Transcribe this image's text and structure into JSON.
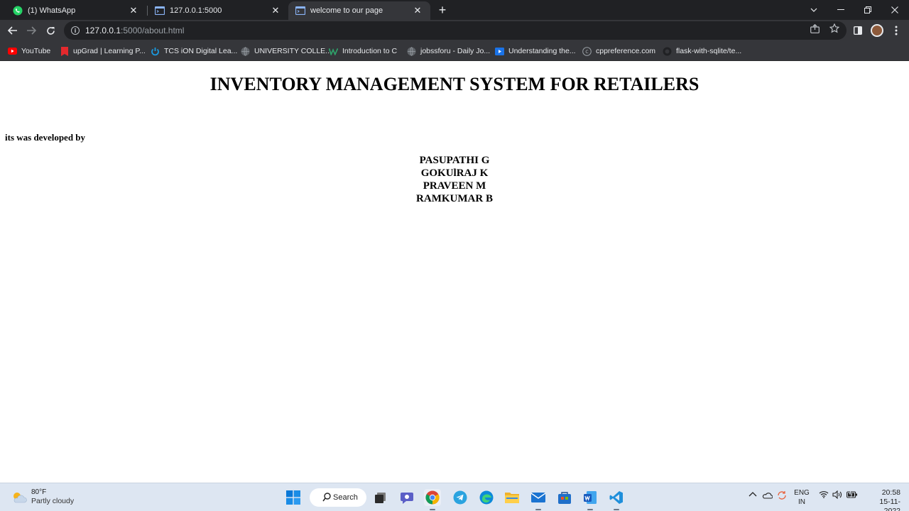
{
  "browser": {
    "tabs": [
      {
        "title": "(1) WhatsApp",
        "icon": "whatsapp-icon",
        "active": false
      },
      {
        "title": "127.0.0.1:5000",
        "icon": "terminal-page-icon",
        "active": false
      },
      {
        "title": "welcome to our page",
        "icon": "terminal-page-icon",
        "active": true
      }
    ],
    "new_tab_label": "+",
    "address": {
      "host": "127.0.0.1",
      "path": ":5000/about.html"
    },
    "bookmarks": [
      {
        "label": "YouTube",
        "icon": "youtube-icon"
      },
      {
        "label": "upGrad | Learning P...",
        "icon": "upgrad-icon"
      },
      {
        "label": "TCS iON Digital Lea...",
        "icon": "tcs-ion-icon"
      },
      {
        "label": "UNIVERSITY COLLE...",
        "icon": "globe-icon"
      },
      {
        "label": "Introduction to C",
        "icon": "w-logo-icon"
      },
      {
        "label": "jobssforu - Daily Jo...",
        "icon": "globe-icon"
      },
      {
        "label": "Understanding the...",
        "icon": "play-icon"
      },
      {
        "label": "cppreference.com",
        "icon": "cpp-icon"
      },
      {
        "label": "flask-with-sqlite/te...",
        "icon": "github-icon"
      }
    ]
  },
  "page": {
    "heading": "INVENTORY MANAGEMENT SYSTEM FOR RETAILERS",
    "developed_by": "its was developed by",
    "developers": [
      "PASUPATHI G",
      "GOKUlRAJ K",
      "PRAVEEN M",
      "RAMKUMAR B"
    ]
  },
  "taskbar": {
    "weather": {
      "temp": "80°F",
      "condition": "Partly cloudy"
    },
    "search_label": "Search",
    "language": {
      "line1": "ENG",
      "line2": "IN"
    },
    "clock": {
      "time": "20:58",
      "date": "15-11-2022"
    }
  }
}
